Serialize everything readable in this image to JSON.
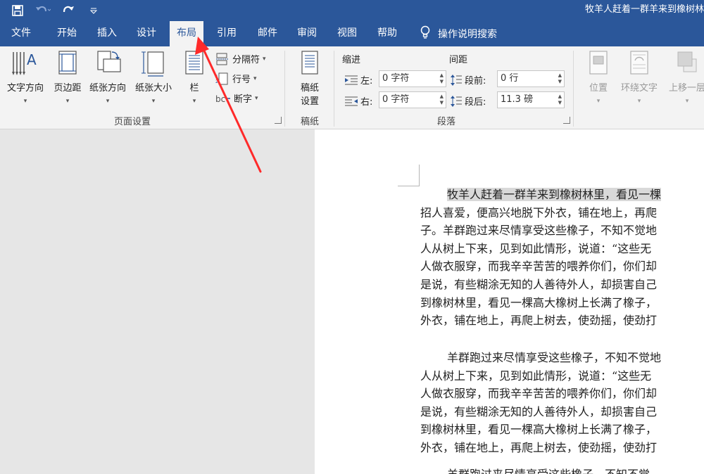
{
  "titlebar": {
    "doc_title": "牧羊人赶着一群羊来到橡树林"
  },
  "tabs": [
    {
      "label": "文件"
    },
    {
      "label": "开始"
    },
    {
      "label": "插入"
    },
    {
      "label": "设计"
    },
    {
      "label": "布局"
    },
    {
      "label": "引用"
    },
    {
      "label": "邮件"
    },
    {
      "label": "审阅"
    },
    {
      "label": "视图"
    },
    {
      "label": "帮助"
    }
  ],
  "tell_me": "操作说明搜索",
  "ribbon": {
    "page_setup": {
      "label": "页面设置",
      "text_direction": "文字方向",
      "margins": "页边距",
      "orientation": "纸张方向",
      "size": "纸张大小",
      "columns": "栏",
      "breaks": "分隔符",
      "line_numbers": "行号",
      "hyphenation": "断字"
    },
    "draft": {
      "label": "稿纸",
      "button_line1": "稿纸",
      "button_line2": "设置"
    },
    "paragraph": {
      "label": "段落",
      "indent_title": "缩进",
      "spacing_title": "间距",
      "left_label": "左:",
      "left_value": "0 字符",
      "right_label": "右:",
      "right_value": "0 字符",
      "before_label": "段前:",
      "before_value": "0 行",
      "after_label": "段后:",
      "after_value": "11.3 磅"
    },
    "arrange": {
      "position": "位置",
      "wrap_text": "环绕文字",
      "bring_forward": "上移一层"
    }
  },
  "document": {
    "paragraph1": [
      "牧羊人赶着一群羊来到橡树林里，看见一棵",
      "招人喜爱，便高兴地脱下外衣，铺在地上，再爬",
      "子。羊群跑过来尽情享受这些橡子，不知不觉地",
      "人从树上下来，见到如此情形，说道：“这些无",
      "人做衣服穿，而我辛辛苦苦的喂养你们，你们却",
      "是说，有些糊涂无知的人善待外人，却损害自己",
      "到橡树林里，看见一棵高大橡树上长满了橡子，",
      "外衣，铺在地上，再爬上树去，使劲摇，使劲打"
    ],
    "paragraph2": [
      "羊群跑过来尽情享受这些橡子，不知不觉地",
      "人从树上下来，见到如此情形，说道：“这些无",
      "人做衣服穿，而我辛辛苦苦的喂养你们，你们却",
      "是说，有些糊涂无知的人善待外人，却损害自己",
      "到橡树林里，看见一棵高大橡树上长满了橡子，",
      "外衣，铺在地上，再爬上树去，使劲摇，使劲打"
    ],
    "paragraph3_partial": "羊群跑过来尽情享受这些橡子，不知不觉"
  },
  "colors": {
    "accent": "#2b579a",
    "annotation": "#ff2a2a"
  }
}
